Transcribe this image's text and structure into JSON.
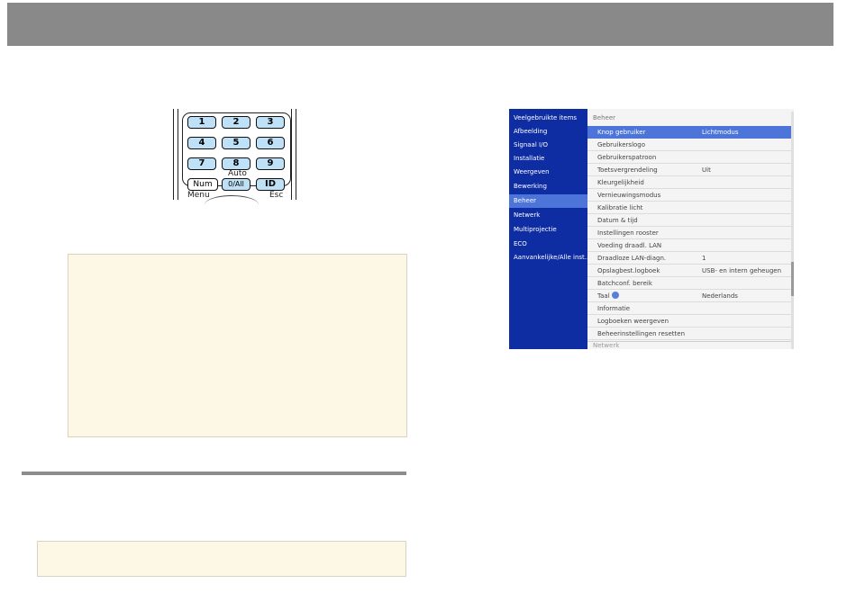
{
  "remote": {
    "keys_row1": [
      "1",
      "2",
      "3"
    ],
    "keys_row2": [
      "4",
      "5",
      "6"
    ],
    "keys_row3": [
      "7",
      "8",
      "9"
    ],
    "auto_label": "Auto",
    "num_key": "Num",
    "all_key": "0/All",
    "id_key": "ID",
    "menu_label": "Menu",
    "esc_label": "Esc"
  },
  "menu": {
    "sidebar": [
      "Veelgebruikte items",
      "Afbeelding",
      "Signaal I/O",
      "Installatie",
      "Weergeven",
      "Bewerking",
      "Beheer",
      "Netwerk",
      "Multiprojectie",
      "ECO",
      "Aanvankelijke/Alle inst..."
    ],
    "active_sidebar": "Beheer",
    "header": "Beheer",
    "rows": [
      {
        "label": "Knop gebruiker",
        "value": "Lichtmodus"
      },
      {
        "label": "Gebruikerslogo",
        "value": ""
      },
      {
        "label": "Gebruikerspatroon",
        "value": ""
      },
      {
        "label": "Toetsvergrendeling",
        "value": "Uit"
      },
      {
        "label": "Kleurgelijkheid",
        "value": ""
      },
      {
        "label": "Vernieuwingsmodus",
        "value": ""
      },
      {
        "label": "Kalibratie licht",
        "value": ""
      },
      {
        "label": "Datum & tijd",
        "value": ""
      },
      {
        "label": "Instellingen rooster",
        "value": ""
      },
      {
        "label": "Voeding draadl. LAN",
        "value": ""
      },
      {
        "label": "Draadloze LAN-diagn.",
        "value": "1"
      },
      {
        "label": "Opslagbest.logboek",
        "value": "USB- en intern geheugen"
      },
      {
        "label": "Batchconf. bereik",
        "value": ""
      },
      {
        "label": "Taal",
        "value": "Nederlands"
      },
      {
        "label": "Informatie",
        "value": ""
      },
      {
        "label": "Logboeken weergeven",
        "value": ""
      },
      {
        "label": "Beheerinstellingen resetten",
        "value": ""
      }
    ],
    "next_section": "Netwerk",
    "icons": {
      "language": "globe-icon"
    },
    "colors": {
      "sidebar_bg": "#0f2da3",
      "highlight": "#4d74d8"
    }
  }
}
